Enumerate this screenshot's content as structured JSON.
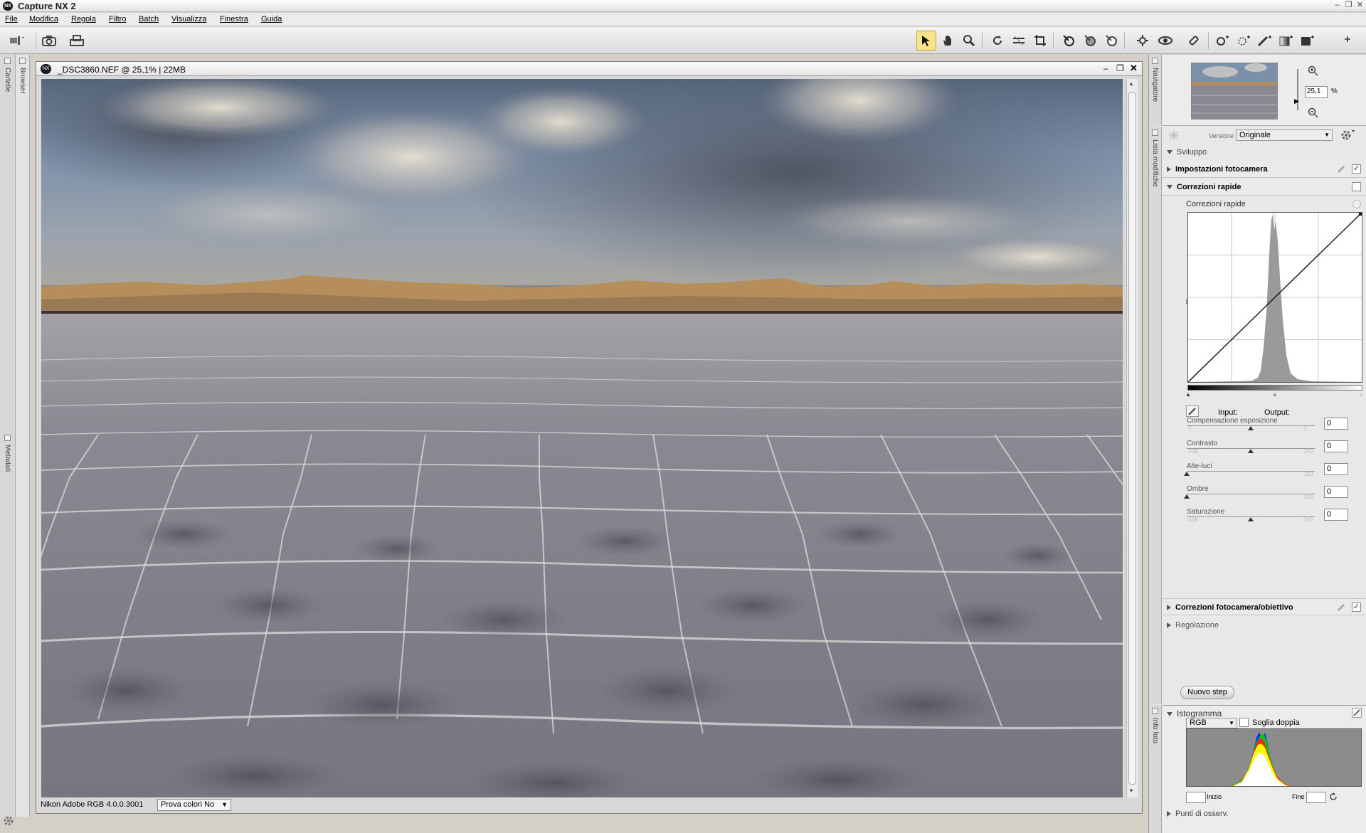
{
  "app": {
    "title": "Capture NX 2",
    "icon_text": "NX"
  },
  "window_controls": {
    "minimize": "–",
    "restore": "❐",
    "close": "✕"
  },
  "menu": [
    "File",
    "Modifica",
    "Regola",
    "Filtro",
    "Batch",
    "Visualizza",
    "Finestra",
    "Guida"
  ],
  "left_tabs": {
    "folders": "Cartelle",
    "browser": "Browser",
    "metadata": "Metadati"
  },
  "image_window": {
    "title": "_DSC3860.NEF @ 25,1% | 22MB",
    "profile": "Nikon Adobe RGB 4.0.0.3001",
    "softproof": "Prova colori No"
  },
  "navigator": {
    "tab": "Navigatore",
    "zoom_value": "25,1",
    "zoom_unit": "%"
  },
  "edit_list": {
    "tab": "Lista modifiche",
    "version_label": "Versione",
    "version_value": "Originale",
    "sviluppo": "Sviluppo",
    "camera_settings": "Impostazioni fotocamera",
    "quick_fix": "Correzioni rapide",
    "quick_fix_sub": "Correzioni rapide",
    "input_label": "Input:",
    "output_label": "Output:",
    "sliders": [
      {
        "label": "Compensazione esposizione",
        "min": "-2",
        "max": "2",
        "value": "0",
        "pos": 0.5
      },
      {
        "label": "Contrasto",
        "min": "-100",
        "max": "100",
        "value": "0",
        "pos": 0.5
      },
      {
        "label": "Alte-luci",
        "min": "",
        "max": "100",
        "value": "0",
        "pos": 0.0
      },
      {
        "label": "Ombre",
        "min": "",
        "max": "100",
        "value": "0",
        "pos": 0.0
      },
      {
        "label": "Saturazione",
        "min": "-100",
        "max": "100",
        "value": "0",
        "pos": 0.5
      }
    ],
    "lens_corrections": "Correzioni fotocamera/obiettivo",
    "adjust": "Regolazione",
    "new_step": "Nuovo step"
  },
  "histogram": {
    "tab": "Info foto",
    "title": "Istogramma",
    "channel": "RGB",
    "double_threshold": "Soglia doppia",
    "start_label": "Inizio",
    "end_label": "Fine",
    "watch_points": "Punti di osserv."
  }
}
